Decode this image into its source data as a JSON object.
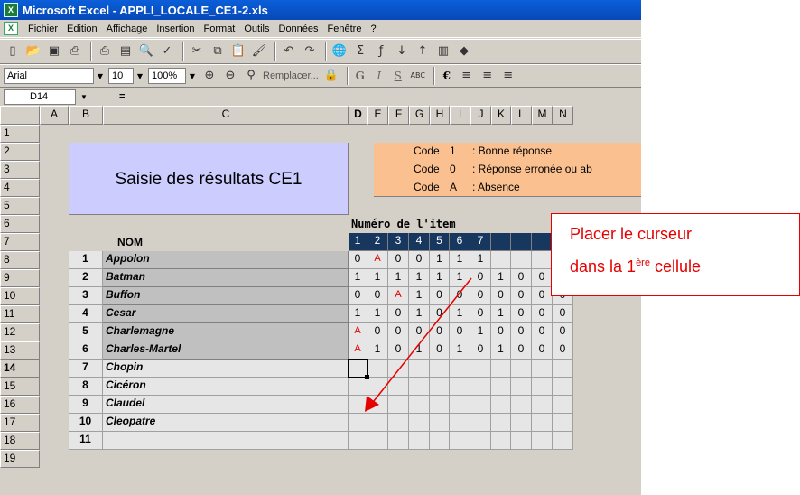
{
  "window": {
    "title": "Microsoft Excel - APPLI_LOCALE_CE1-2.xls",
    "app_icon": "excel-icon"
  },
  "menu": [
    "Fichier",
    "Edition",
    "Affichage",
    "Insertion",
    "Format",
    "Outils",
    "Données",
    "Fenêtre",
    "?"
  ],
  "toolbar_format": {
    "font": "Arial",
    "size": "10",
    "zoom": "100%",
    "replace_label": "Remplacer...",
    "bold": "G",
    "italic": "I",
    "underline": "S",
    "euro": "€"
  },
  "formula_bar": {
    "name_box": "D14",
    "equals": "=",
    "value": ""
  },
  "columns": [
    "A",
    "B",
    "C",
    "D",
    "E",
    "F",
    "G",
    "H",
    "I",
    "J",
    "K",
    "L",
    "M",
    "N"
  ],
  "active_column": "D",
  "active_row": "14",
  "sheet": {
    "title": "Saisie des résultats CE1",
    "codes": [
      {
        "label": "Code",
        "code": "1",
        "desc": ": Bonne réponse"
      },
      {
        "label": "Code",
        "code": "0",
        "desc": ": Réponse erronée ou ab"
      },
      {
        "label": "Code",
        "code": "A",
        "desc": ": Absence"
      }
    ],
    "item_header": "Numéro de l'item",
    "nom_header": "NOM",
    "item_numbers": [
      "1",
      "2",
      "3",
      "4",
      "5",
      "6",
      "7",
      "",
      "",
      "",
      "",
      ""
    ],
    "students": [
      {
        "num": "1",
        "name": "Appolon",
        "scores": [
          "0",
          "A",
          "0",
          "0",
          "1",
          "1",
          "1",
          "",
          "",
          "",
          "",
          ""
        ]
      },
      {
        "num": "2",
        "name": "Batman",
        "scores": [
          "1",
          "1",
          "1",
          "1",
          "1",
          "1",
          "0",
          "1",
          "0",
          "0",
          "0",
          ""
        ]
      },
      {
        "num": "3",
        "name": "Buffon",
        "scores": [
          "0",
          "0",
          "A",
          "1",
          "0",
          "0",
          "0",
          "0",
          "0",
          "0",
          "0",
          ""
        ]
      },
      {
        "num": "4",
        "name": "Cesar",
        "scores": [
          "1",
          "1",
          "0",
          "1",
          "0",
          "1",
          "0",
          "1",
          "0",
          "0",
          "0",
          ""
        ]
      },
      {
        "num": "5",
        "name": "Charlemagne",
        "scores": [
          "A",
          "0",
          "0",
          "0",
          "0",
          "0",
          "1",
          "0",
          "0",
          "0",
          "0",
          ""
        ]
      },
      {
        "num": "6",
        "name": "Charles-Martel",
        "scores": [
          "A",
          "1",
          "0",
          "1",
          "0",
          "1",
          "0",
          "1",
          "0",
          "0",
          "0",
          ""
        ]
      },
      {
        "num": "7",
        "name": "Chopin",
        "scores": [
          "",
          "",
          "",
          "",
          "",
          "",
          "",
          "",
          "",
          "",
          "",
          ""
        ]
      },
      {
        "num": "8",
        "name": "Cicéron",
        "scores": [
          "",
          "",
          "",
          "",
          "",
          "",
          "",
          "",
          "",
          "",
          "",
          ""
        ]
      },
      {
        "num": "9",
        "name": "Claudel",
        "scores": [
          "",
          "",
          "",
          "",
          "",
          "",
          "",
          "",
          "",
          "",
          "",
          ""
        ]
      },
      {
        "num": "10",
        "name": "Cleopatre",
        "scores": [
          "",
          "",
          "",
          "",
          "",
          "",
          "",
          "",
          "",
          "",
          "",
          ""
        ]
      },
      {
        "num": "11",
        "name": "",
        "scores": [
          "",
          "",
          "",
          "",
          "",
          "",
          "",
          "",
          "",
          "",
          "",
          ""
        ]
      }
    ]
  },
  "callout": {
    "line1": "Placer le curseur",
    "line2_prefix": "dans la 1",
    "line2_sup": "ère",
    "line2_suffix": " cellule"
  },
  "colors": {
    "title_bg": "#ccccff",
    "legend_bg": "#fac090",
    "item_header_bg": "#17375e",
    "score_red": "#e00000",
    "callout_red": "#e60000"
  }
}
